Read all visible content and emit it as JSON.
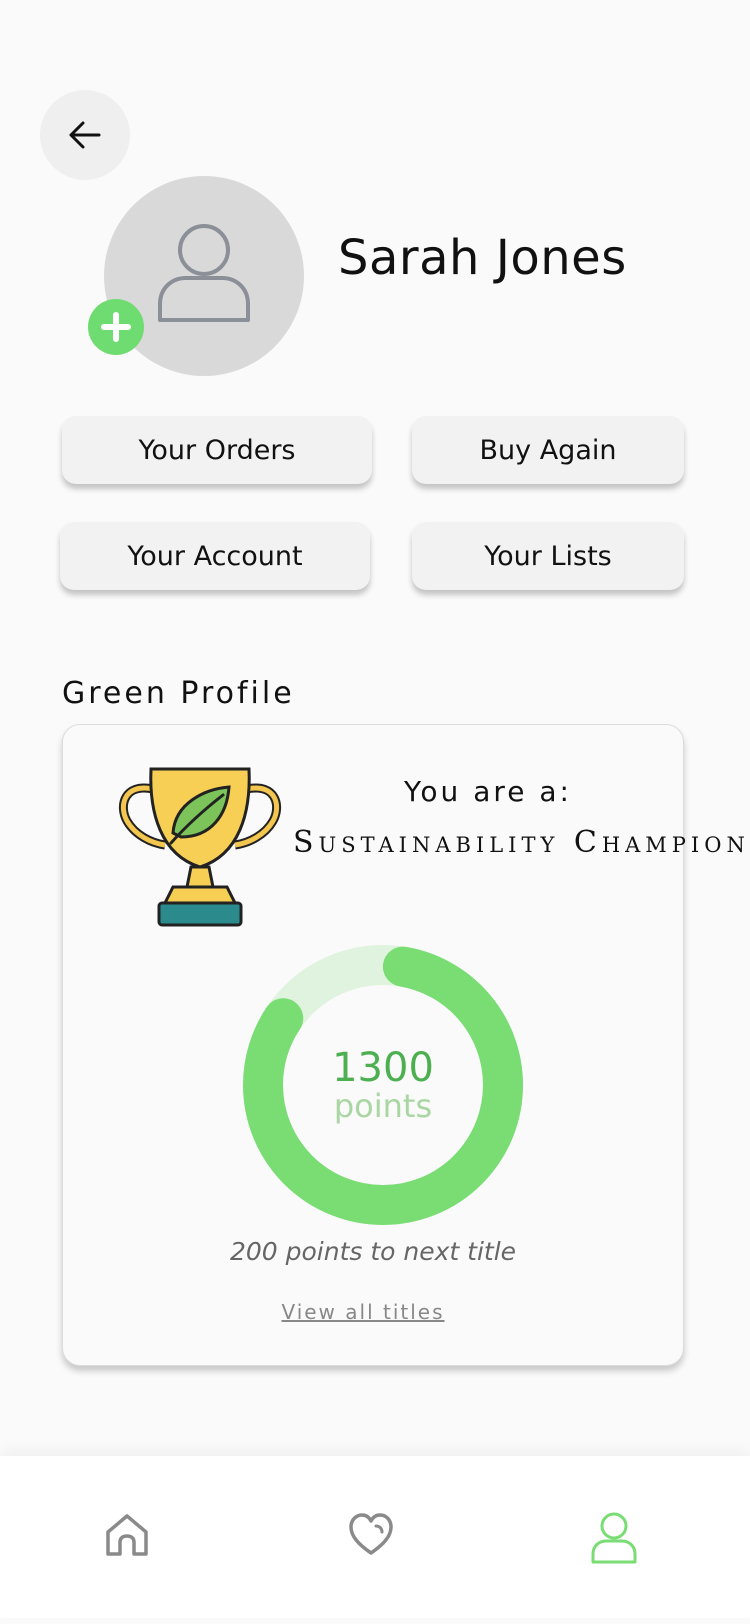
{
  "header": {
    "back_icon": "arrow-left-icon"
  },
  "profile": {
    "name": "Sarah Jones",
    "avatar_icon": "user-icon",
    "add_photo_icon": "plus-icon"
  },
  "quick_actions": [
    {
      "label": "Your Orders"
    },
    {
      "label": "Buy Again"
    },
    {
      "label": "Your Account"
    },
    {
      "label": "Your Lists"
    }
  ],
  "green_profile": {
    "section_title": "Green Profile",
    "you_are_label": "You are a:",
    "title": "Sustainability Champion",
    "trophy_icon": "trophy-leaf-icon",
    "points_value": "1300",
    "points_label": "points",
    "progress_fraction": 0.87,
    "next_title_text": "200 points to next title",
    "view_all_link": "View all titles",
    "colors": {
      "ring_fill": "#79dd74",
      "ring_track": "#e0f3de",
      "points_number": "#4caf50",
      "points_label": "#a9d6a2"
    }
  },
  "bottom_nav": {
    "items": [
      {
        "icon": "home-icon",
        "active": false
      },
      {
        "icon": "heart-icon",
        "active": false
      },
      {
        "icon": "profile-icon",
        "active": true
      }
    ],
    "active_color": "#79dd74",
    "inactive_color": "#8a8a8a"
  }
}
